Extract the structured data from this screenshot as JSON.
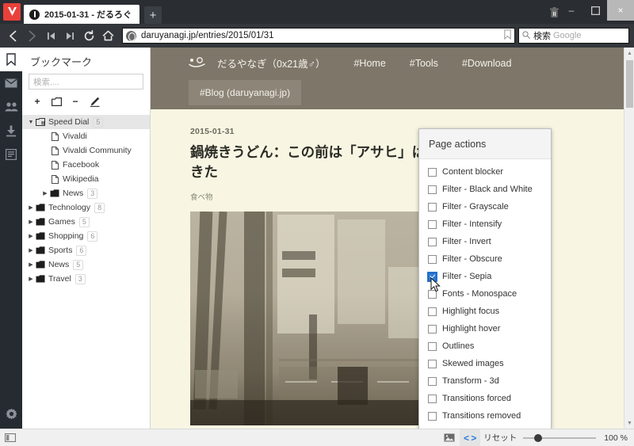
{
  "window": {
    "tab": {
      "title": "2015-01-31 - だるろぐ",
      "favicon": "vivaldi-tab-favicon"
    },
    "newtab_label": "+",
    "controls": {
      "minimize": "–",
      "maximize": "❐",
      "close": "×"
    },
    "trash_icon": "trash-icon",
    "logo": "vivaldi-logo"
  },
  "navbar": {
    "back": "‹",
    "forward": "›",
    "rewind": "⏮",
    "fastforward": "⏭",
    "reload": "↻",
    "home": "⌂",
    "url": "daruyanagi.jp/entries/2015/01/31",
    "bookmark_icon": "☐",
    "search_icon": "⚲",
    "search_value": "検索",
    "search_placeholder": "Google"
  },
  "rail": {
    "items": [
      {
        "name": "bookmarks",
        "icon": "bookmark-icon",
        "active": true
      },
      {
        "name": "mail",
        "icon": "mail-icon",
        "active": false
      },
      {
        "name": "contacts",
        "icon": "contacts-icon",
        "active": false
      },
      {
        "name": "downloads",
        "icon": "download-icon",
        "active": false
      },
      {
        "name": "notes",
        "icon": "notes-icon",
        "active": false
      }
    ],
    "settings_icon": "gear-icon"
  },
  "panel": {
    "title": "ブックマーク",
    "search_placeholder": "検索....",
    "tools": [
      {
        "name": "add-bookmark",
        "label": "+"
      },
      {
        "name": "add-folder",
        "label": "□"
      },
      {
        "name": "remove-bookmark",
        "label": "−"
      },
      {
        "name": "edit-bookmark",
        "label": "✎"
      }
    ],
    "bookmarks": [
      {
        "label": "Speed Dial",
        "count": "5",
        "type": "folder-open",
        "depth": 0,
        "selected": true,
        "expanded": true
      },
      {
        "label": "Vivaldi",
        "count": "",
        "type": "page",
        "depth": 1,
        "selected": false,
        "expanded": false
      },
      {
        "label": "Vivaldi Community",
        "count": "",
        "type": "page",
        "depth": 1,
        "selected": false,
        "expanded": false
      },
      {
        "label": "Facebook",
        "count": "",
        "type": "page",
        "depth": 1,
        "selected": false,
        "expanded": false
      },
      {
        "label": "Wikipedia",
        "count": "",
        "type": "page",
        "depth": 1,
        "selected": false,
        "expanded": false
      },
      {
        "label": "News",
        "count": "3",
        "type": "folder",
        "depth": 1,
        "selected": false,
        "expanded": false
      },
      {
        "label": "Technology",
        "count": "8",
        "type": "folder",
        "depth": 0,
        "selected": false,
        "expanded": false
      },
      {
        "label": "Games",
        "count": "5",
        "type": "folder",
        "depth": 0,
        "selected": false,
        "expanded": false
      },
      {
        "label": "Shopping",
        "count": "6",
        "type": "folder",
        "depth": 0,
        "selected": false,
        "expanded": false
      },
      {
        "label": "Sports",
        "count": "6",
        "type": "folder",
        "depth": 0,
        "selected": false,
        "expanded": false
      },
      {
        "label": "News",
        "count": "5",
        "type": "folder",
        "depth": 0,
        "selected": false,
        "expanded": false
      },
      {
        "label": "Travel",
        "count": "3",
        "type": "folder",
        "depth": 0,
        "selected": false,
        "expanded": false
      }
    ]
  },
  "page": {
    "brand": "だるやなぎ（0x21歳♂）",
    "nav": [
      {
        "label": "#Home"
      },
      {
        "label": "#Tools"
      },
      {
        "label": "#Download"
      }
    ],
    "active_tab": "#Blog (daruyanagi.jp)",
    "article": {
      "date": "2015-01-31",
      "title": "鍋焼きうどん：この前は「アサヒ」は「ことり」に行ってきた",
      "category": "食べ物",
      "photo_alt": "street-view-photo"
    }
  },
  "popup": {
    "title": "Page actions",
    "items": [
      {
        "label": "Content blocker",
        "checked": false
      },
      {
        "label": "Filter - Black and White",
        "checked": false
      },
      {
        "label": "Filter - Grayscale",
        "checked": false
      },
      {
        "label": "Filter - Intensify",
        "checked": false
      },
      {
        "label": "Filter - Invert",
        "checked": false
      },
      {
        "label": "Filter - Obscure",
        "checked": false
      },
      {
        "label": "Filter - Sepia",
        "checked": true
      },
      {
        "label": "Fonts - Monospace",
        "checked": false
      },
      {
        "label": "Highlight focus",
        "checked": false
      },
      {
        "label": "Highlight hover",
        "checked": false
      },
      {
        "label": "Outlines",
        "checked": false
      },
      {
        "label": "Skewed images",
        "checked": false
      },
      {
        "label": "Transform - 3d",
        "checked": false
      },
      {
        "label": "Transitions forced",
        "checked": false
      },
      {
        "label": "Transitions removed",
        "checked": false
      }
    ]
  },
  "statusbar": {
    "panel_toggle_icon": "panel-toggle-icon",
    "image_icon": "image-icon",
    "page_actions_icon": "code-brackets-icon",
    "reset_label": "リセット",
    "zoom_level": "100 %"
  },
  "colors": {
    "accent_blue": "#2b7bd8",
    "vivaldi_red": "#e8413a",
    "chrome_dark": "#2a2e33",
    "page_bg": "#f8f6e3",
    "site_header": "#7e7669"
  }
}
